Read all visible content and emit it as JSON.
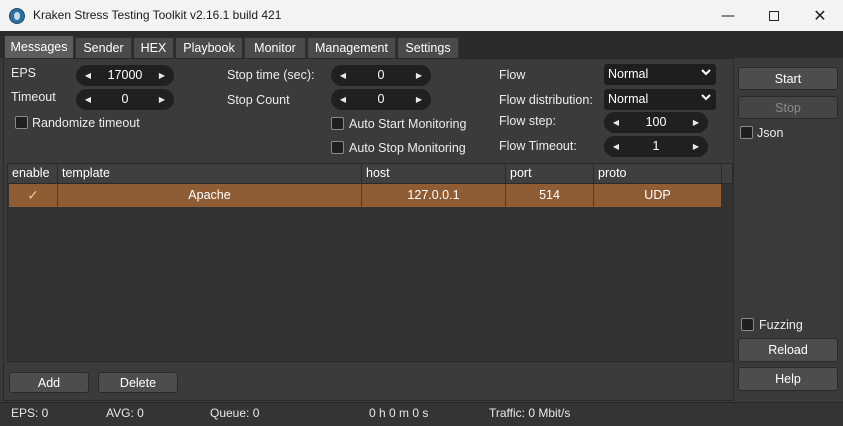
{
  "window": {
    "title": "Kraken Stress Testing Toolkit v2.16.1 build 421"
  },
  "tabs": [
    {
      "label": "Messages",
      "active": true
    },
    {
      "label": "Sender"
    },
    {
      "label": "HEX"
    },
    {
      "label": "Playbook"
    },
    {
      "label": "Monitor"
    },
    {
      "label": "Management"
    },
    {
      "label": "Settings"
    }
  ],
  "settings": {
    "eps": {
      "label": "EPS",
      "value": "17000"
    },
    "timeout": {
      "label": "Timeout",
      "value": "0"
    },
    "randomize_timeout": {
      "label": "Randomize timeout",
      "checked": false
    },
    "stop_time": {
      "label": "Stop time (sec):",
      "value": "0"
    },
    "stop_count": {
      "label": "Stop Count",
      "value": "0"
    },
    "auto_start_monitoring": {
      "label": "Auto Start Monitoring",
      "checked": false
    },
    "auto_stop_monitoring": {
      "label": "Auto Stop Monitoring",
      "checked": false
    },
    "flow": {
      "label": "Flow",
      "value": "Normal"
    },
    "flow_distribution": {
      "label": "Flow distribution:",
      "value": "Normal"
    },
    "flow_step": {
      "label": "Flow step:",
      "value": "100"
    },
    "flow_timeout": {
      "label": "Flow Timeout:",
      "value": "1"
    }
  },
  "table": {
    "columns": [
      "enable",
      "template",
      "host",
      "port",
      "proto"
    ],
    "rows": [
      {
        "enable": "✓",
        "template": "Apache",
        "host": "127.0.0.1",
        "port": "514",
        "proto": "UDP"
      }
    ]
  },
  "buttons": {
    "add": "Add",
    "delete": "Delete",
    "start": "Start",
    "stop": "Stop",
    "reload": "Reload",
    "help": "Help"
  },
  "side": {
    "json": {
      "label": "Json",
      "checked": false
    },
    "fuzzing": {
      "label": "Fuzzing",
      "checked": false
    }
  },
  "status": {
    "eps": "EPS: 0",
    "avg": "AVG: 0",
    "queue": "Queue: 0",
    "elapsed": "0 h 0 m 0 s",
    "traffic": "Traffic: 0 Mbit/s"
  },
  "colors": {
    "selected_row": "#8e5d36",
    "background": "#3a3a3a",
    "spinbox": "#202020"
  }
}
